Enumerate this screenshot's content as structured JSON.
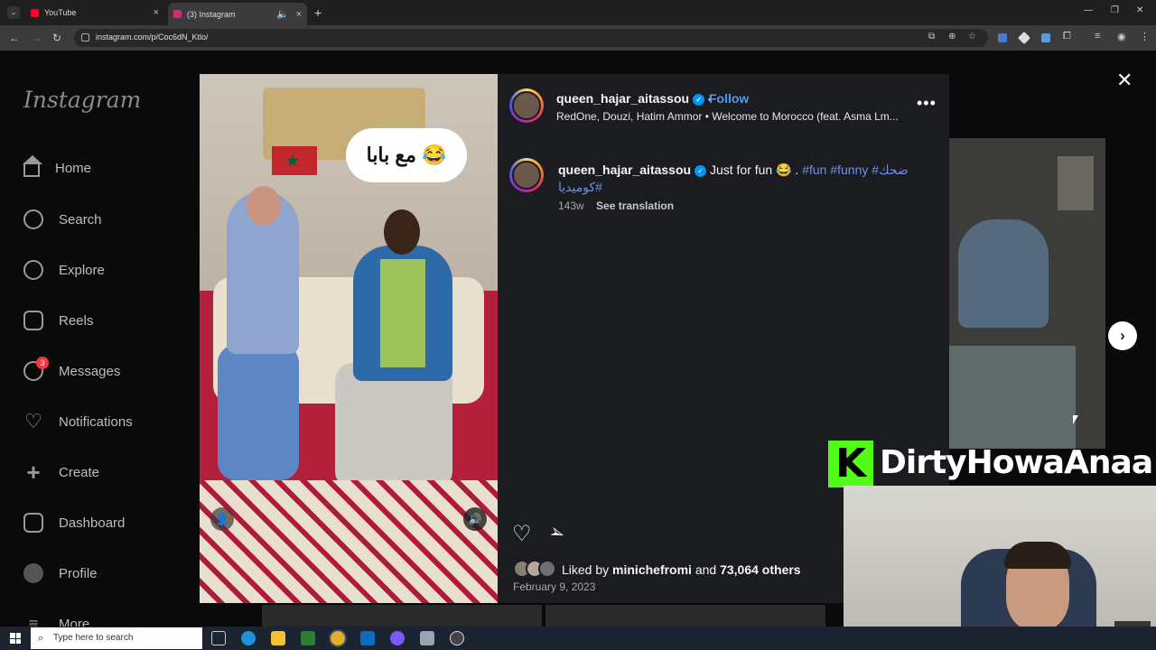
{
  "browser": {
    "tabs": [
      {
        "title": "YouTube",
        "icon": "youtube-icon",
        "color": "#ff0033"
      },
      {
        "title": "(3) Instagram",
        "icon": "instagram-icon",
        "color": "#d62976"
      }
    ],
    "url": "instagram.com/p/Coc6dN_Ktlo/"
  },
  "sidebar": {
    "logo": "Instagram",
    "items": [
      {
        "label": "Home",
        "icon": "home-icon"
      },
      {
        "label": "Search",
        "icon": "search-icon"
      },
      {
        "label": "Explore",
        "icon": "compass-icon"
      },
      {
        "label": "Reels",
        "icon": "reels-icon"
      },
      {
        "label": "Messages",
        "icon": "messenger-icon"
      },
      {
        "label": "Notifications",
        "icon": "heart-icon"
      },
      {
        "label": "Create",
        "icon": "plus-icon"
      },
      {
        "label": "Dashboard",
        "icon": "dashboard-icon"
      },
      {
        "label": "Profile",
        "icon": "avatar"
      },
      {
        "label": "More",
        "icon": "menu-icon"
      }
    ],
    "messages_badge": "3"
  },
  "post": {
    "username": "queen_hajar_aitassou",
    "follow_label": "Follow",
    "separator": "•",
    "audio": "RedOne, Douzi, Hatim Ammor • Welcome to Morocco (feat. Asma Lm...",
    "video_sticker_text": "مع بابا 😂",
    "caption_text": "Just for fun 😂 .",
    "hashtags": "#fun #funny #ضحك #كوميديا",
    "age": "143w",
    "see_translation": "See translation",
    "liked_by_prefix": "Liked by",
    "liked_by_user": "minichefromi",
    "liked_by_and": "and",
    "liked_by_others": "73,064 others",
    "date": "February 9, 2023"
  },
  "overlay": {
    "brand_letter": "K",
    "brand_name": "DirtyHowaAnaa"
  },
  "taskbar": {
    "search_placeholder": "Type here to search"
  }
}
